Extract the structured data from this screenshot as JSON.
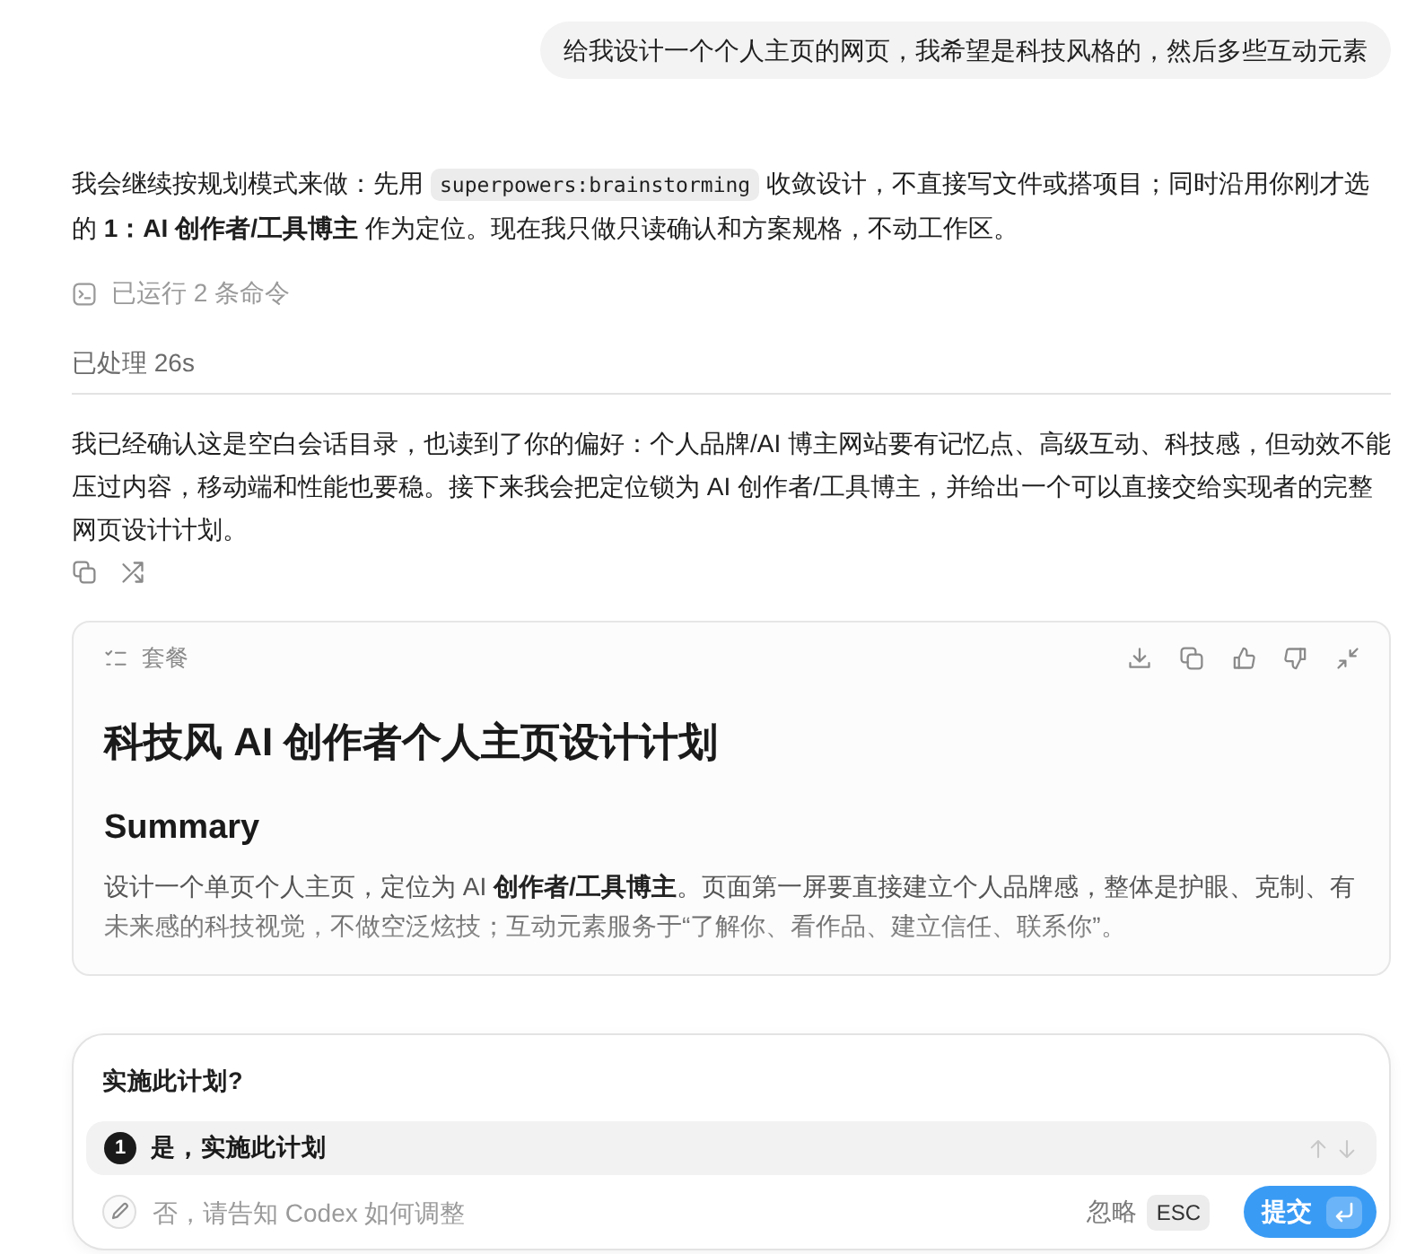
{
  "user_message": {
    "text": "给我设计一个个人主页的网页，我希望是科技风格的，然后多些互动元素"
  },
  "intro_message": {
    "segments": [
      {
        "kind": "text",
        "text": "我会继续按规划模式来做：先用"
      },
      {
        "kind": "code",
        "text": "superpowers:brainstorming"
      },
      {
        "kind": "text",
        "text": "收敛设计，不直接写文件或搭项目；同时沿用你刚才选的 **1：AI 创作者/工具博主** 作为定位。现在我只做只读确认和方案规格，不动工作区。"
      }
    ]
  },
  "command_summary": "已运行 2 条命令",
  "processed_label": "已处理 26s",
  "reply_message": "我已经确认这是空白会话目录，也读到了你的偏好：个人品牌/AI 博主网站要有记忆点、高级互动、科技感，但动效不能压过内容，移动端和性能也要稳。接下来我会把定位锁为 AI 创作者/工具博主，并给出一个可以直接交给实现者的完整网页设计计划。",
  "plan_card": {
    "label": "套餐",
    "title": "科技风 AI 创作者个人主页设计计划",
    "section_heading": "Summary",
    "summary": "设计一个单页个人主页，定位为 AI **创作者/工具博主**。页面第一屏要直接建立个人品牌感，整体是护眼、克制、有未来感的科技视觉，不做空泛炫技；互动元素服务于“了解你、看作品、建立信任、联系你”。"
  },
  "prompt": {
    "question": "实施此计划?",
    "options": [
      {
        "number": "1",
        "label": "是，实施此计划",
        "selected": true
      }
    ],
    "custom_placeholder": "否，请告知 Codex 如何调整",
    "dismiss_label": "忽略",
    "dismiss_key": "ESC",
    "submit_label": "提交"
  }
}
